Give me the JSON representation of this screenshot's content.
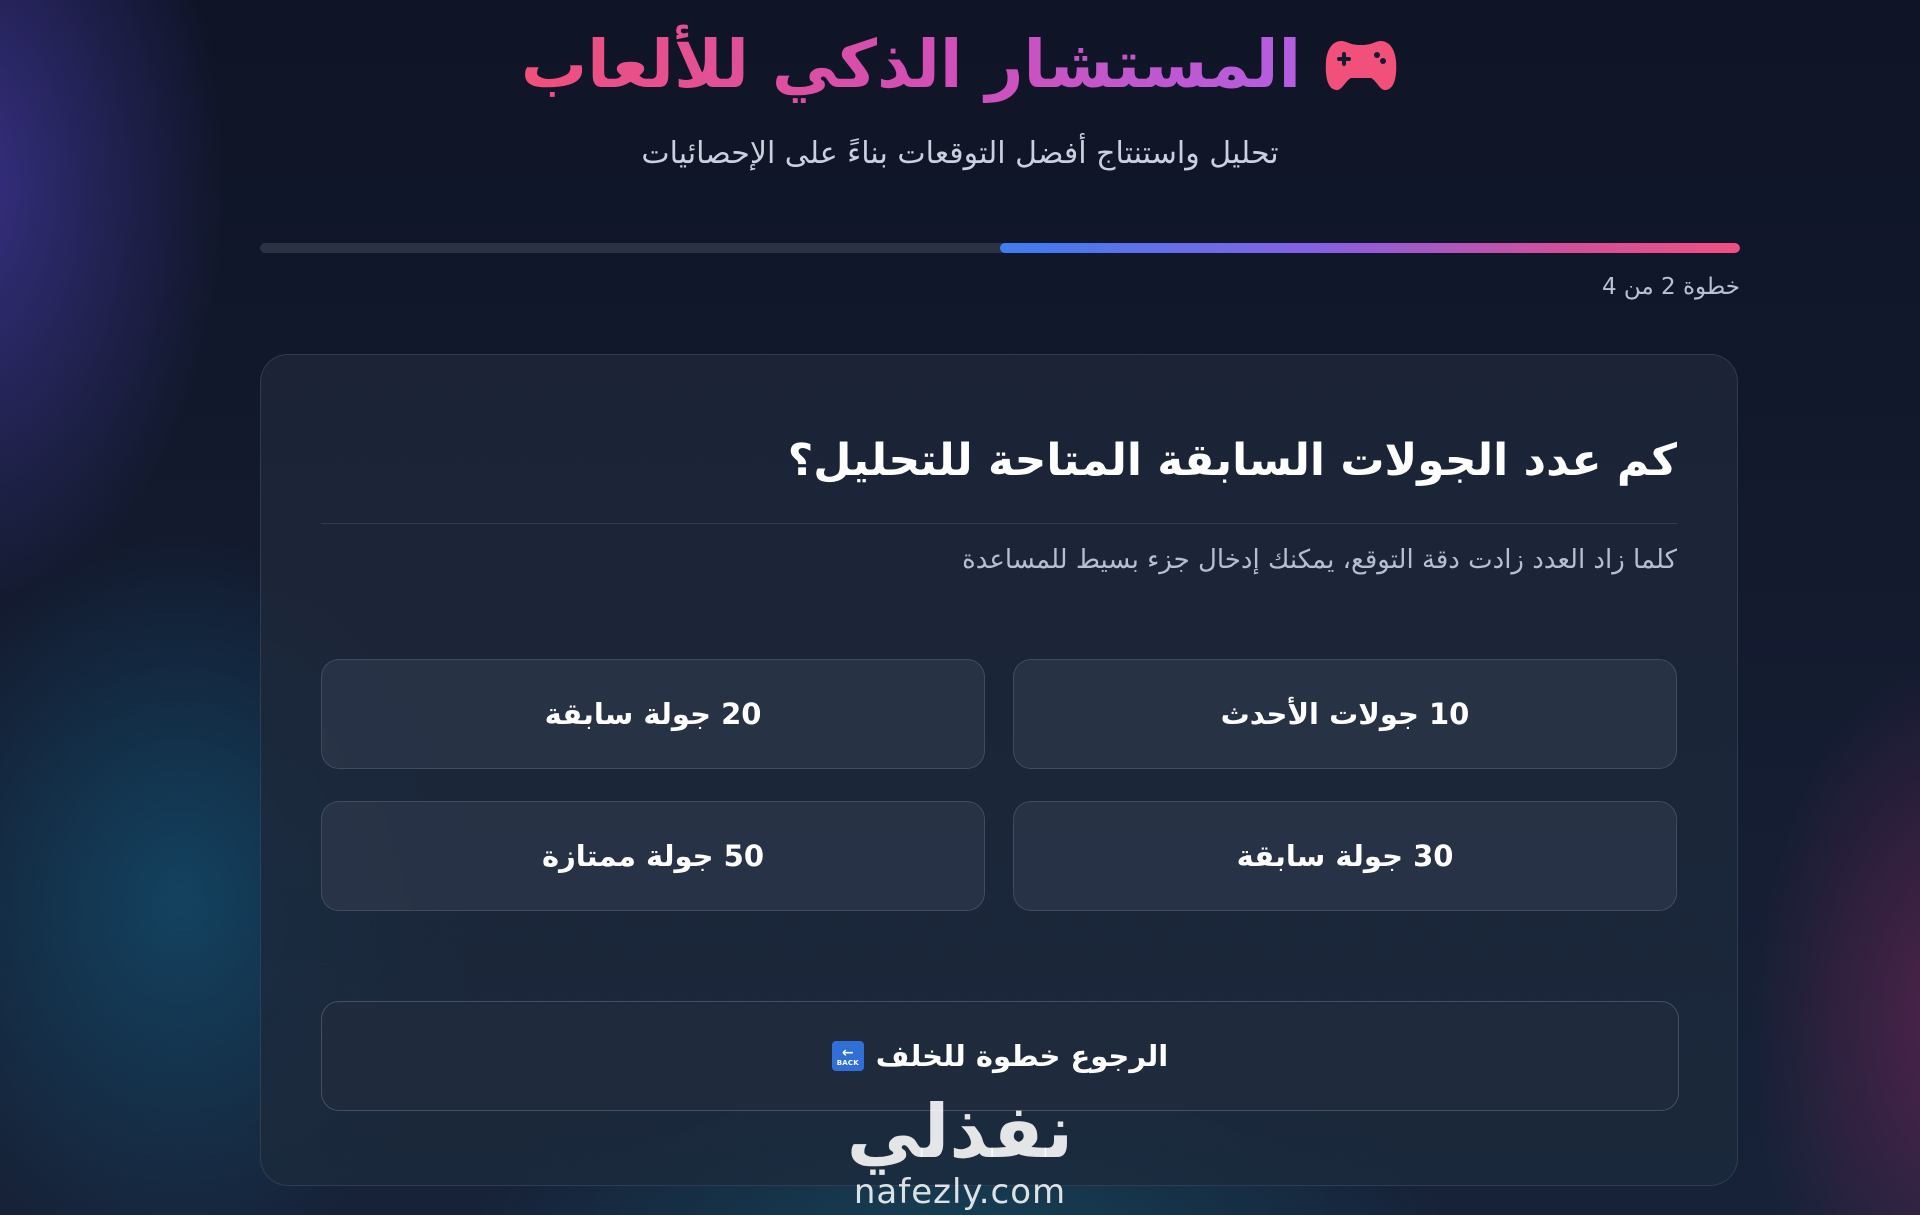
{
  "header": {
    "title": "المستشار الذكي للألعاب",
    "title_icon": "gamepad-icon",
    "subtitle": "تحليل واستنتاج أفضل التوقعات بناءً على الإحصائيات"
  },
  "progress": {
    "step_label": "خطوة 2 من 4",
    "current_step": 2,
    "total_steps": 4,
    "fraction": 0.5
  },
  "card": {
    "question": "كم عدد الجولات السابقة المتاحة للتحليل؟",
    "hint": "كلما زاد العدد زادت دقة التوقع، يمكنك إدخال جزء بسيط للمساعدة",
    "options": [
      {
        "label": "10 جولات الأحدث"
      },
      {
        "label": "20 جولة سابقة"
      },
      {
        "label": "30 جولة سابقة"
      },
      {
        "label": "50 جولة ممتازة"
      }
    ],
    "back_button": {
      "label": "الرجوع خطوة للخلف",
      "icon": "back-arrow-icon",
      "icon_text": "BACK"
    }
  },
  "watermark": {
    "arabic": "نفذلي",
    "latin": "nafezly.com"
  },
  "colors": {
    "title_gradient_start": "#f0507a",
    "title_gradient_end": "#b35ee0",
    "progress_start": "#3f7df0",
    "progress_end": "#f04f82",
    "gamepad": "#f0507a"
  }
}
